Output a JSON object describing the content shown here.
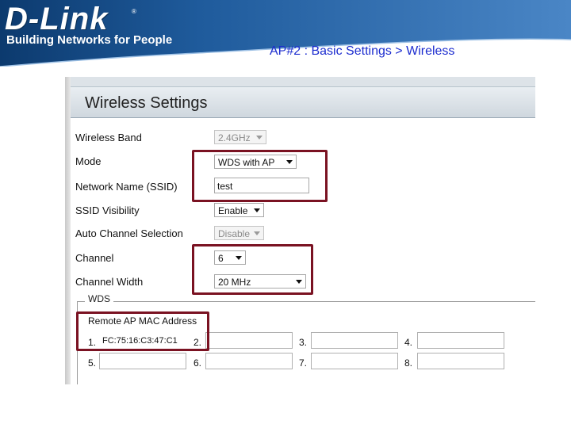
{
  "header": {
    "brand": "D-Link",
    "brand_reg": "®",
    "tagline": "Building Networks for People",
    "caption": "AP#2 : Basic Settings > Wireless",
    "colors": {
      "banner_dark": "#0c3a6e",
      "banner_light": "#3b76b8",
      "caption": "#1d2dcf"
    }
  },
  "panel": {
    "title": "Wireless Settings",
    "fields": {
      "wireless_band": {
        "label": "Wireless Band",
        "value": "2.4GHz"
      },
      "mode": {
        "label": "Mode",
        "value": "WDS with AP"
      },
      "ssid": {
        "label": "Network Name (SSID)",
        "value": "test"
      },
      "ssid_visibility": {
        "label": "SSID Visibility",
        "value": "Enable"
      },
      "auto_channel": {
        "label": "Auto Channel Selection",
        "value": "Disable"
      },
      "channel": {
        "label": "Channel",
        "value": "6"
      },
      "channel_width": {
        "label": "Channel Width",
        "value": "20 MHz"
      }
    },
    "wds": {
      "legend": "WDS",
      "mac_label": "Remote AP MAC Address",
      "entries": [
        {
          "num": "1.",
          "value": "FC:75:16:C3:47:C1"
        },
        {
          "num": "2.",
          "value": ""
        },
        {
          "num": "3.",
          "value": ""
        },
        {
          "num": "4.",
          "value": ""
        },
        {
          "num": "5.",
          "value": ""
        },
        {
          "num": "6.",
          "value": ""
        },
        {
          "num": "7.",
          "value": ""
        },
        {
          "num": "8.",
          "value": ""
        }
      ]
    },
    "highlight_color": "#7a1222"
  }
}
